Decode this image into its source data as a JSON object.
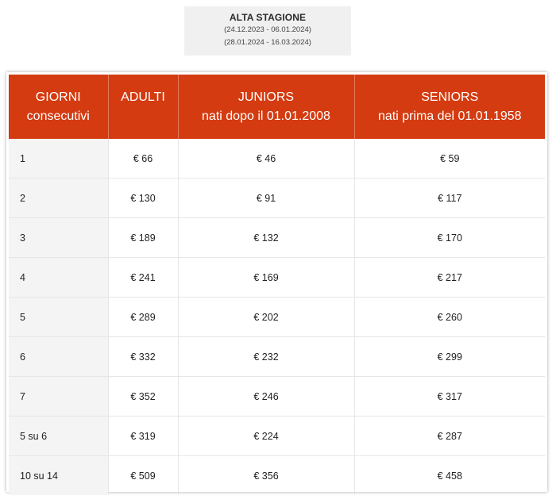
{
  "season": {
    "title": "ALTA STAGIONE",
    "range_1": "(24.12.2023 - 06.01.2024)",
    "range_2": "(28.01.2024 - 16.03.2024)"
  },
  "table": {
    "headers": {
      "days_line1": "GIORNI",
      "days_line2": "consecutivi",
      "adults": "ADULTI",
      "juniors_line1": "JUNIORS",
      "juniors_line2": "nati dopo il 01.01.2008",
      "seniors_line1": "SENIORS",
      "seniors_line2": "nati prima del 01.01.1958"
    },
    "rows": [
      {
        "days": "1",
        "adults": "€ 66",
        "juniors": "€ 46",
        "seniors": "€ 59"
      },
      {
        "days": "2",
        "adults": "€ 130",
        "juniors": "€ 91",
        "seniors": "€ 117"
      },
      {
        "days": "3",
        "adults": "€ 189",
        "juniors": "€ 132",
        "seniors": "€ 170"
      },
      {
        "days": "4",
        "adults": "€ 241",
        "juniors": "€ 169",
        "seniors": "€ 217"
      },
      {
        "days": "5",
        "adults": "€ 289",
        "juniors": "€ 202",
        "seniors": "€ 260"
      },
      {
        "days": "6",
        "adults": "€ 332",
        "juniors": "€ 232",
        "seniors": "€ 299"
      },
      {
        "days": "7",
        "adults": "€ 352",
        "juniors": "€ 246",
        "seniors": "€ 317"
      },
      {
        "days": "5 su 6",
        "adults": "€ 319",
        "juniors": "€ 224",
        "seniors": "€ 287"
      },
      {
        "days": "10 su 14",
        "adults": "€ 509",
        "juniors": "€ 356",
        "seniors": "€ 458"
      }
    ]
  },
  "colors": {
    "header_bg": "#d43b10",
    "header_text": "#ffffff",
    "days_column_bg": "#f4f4f4",
    "season_box_bg": "#f0f0f0"
  }
}
